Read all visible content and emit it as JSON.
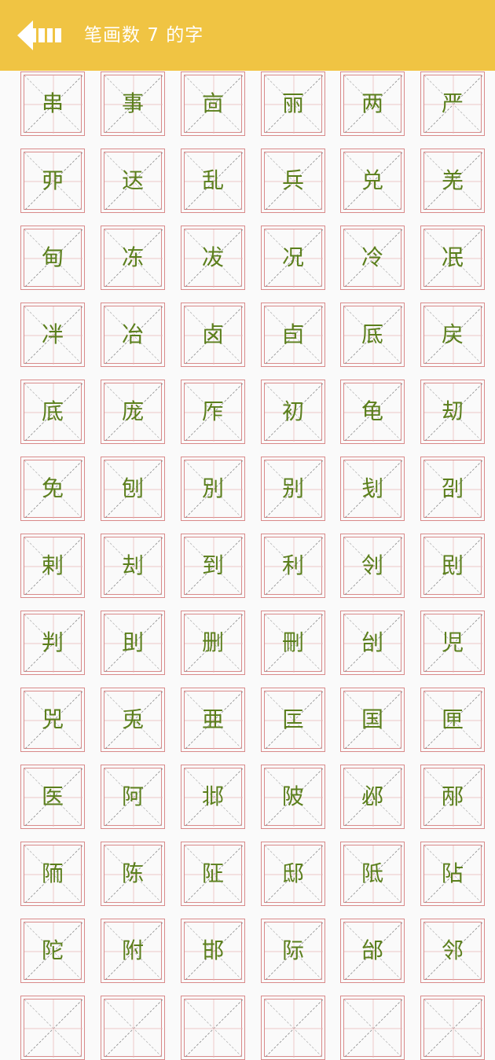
{
  "header": {
    "title": "笔画数 7 的字",
    "back_icon": "back-arrow-icon",
    "background_color": "#f0c443"
  },
  "colors": {
    "character": "#5b7f1c",
    "grid_line": "#d98a8a"
  },
  "characters": [
    "串",
    "事",
    "㐭",
    "丽",
    "两",
    "严",
    "丣",
    "迗",
    "乱",
    "兵",
    "兑",
    "羌",
    "甸",
    "冻",
    "冹",
    "况",
    "冷",
    "冺",
    "冸",
    "冶",
    "卤",
    "卣",
    "厎",
    "戻",
    "底",
    "庞",
    "厏",
    "初",
    "龟",
    "刧",
    "免",
    "刨",
    "別",
    "别",
    "刬",
    "刟",
    "剌",
    "刦",
    "到",
    "利",
    "刢",
    "刡",
    "判",
    "刞",
    "删",
    "刪",
    "刣",
    "児",
    "兕",
    "兎",
    "亜",
    "匞",
    "国",
    "匣",
    "医",
    "阿",
    "邶",
    "陂",
    "邲",
    "邴",
    "陑",
    "陈",
    "阷",
    "邸",
    "阺",
    "阽",
    "陀",
    "附",
    "邯",
    "际",
    "邰",
    "邻",
    "",
    "",
    "",
    "",
    "",
    ""
  ]
}
